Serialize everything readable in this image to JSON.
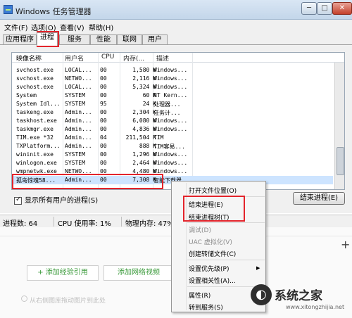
{
  "window": {
    "title": "Windows 任务管理器"
  },
  "window_controls": {
    "minimize": "─",
    "maximize": "□",
    "close": "✕"
  },
  "menu": {
    "items": [
      "文件(F)",
      "选项(O)",
      "查看(V)",
      "帮助(H)"
    ]
  },
  "tabs": [
    "应用程序",
    "进程",
    "服务",
    "性能",
    "联网",
    "用户"
  ],
  "active_tab": "进程",
  "table": {
    "headers": [
      "映像名称",
      "用户名",
      "CPU",
      "内存(...",
      "描述"
    ],
    "rows": [
      [
        "svchost.exe",
        "LOCAL...",
        "00",
        "1,580 K",
        "Windows..."
      ],
      [
        "svchost.exe",
        "NETWO...",
        "00",
        "2,116 K",
        "Windows..."
      ],
      [
        "svchost.exe",
        "LOCAL...",
        "00",
        "5,324 K",
        "Windows..."
      ],
      [
        "System",
        "SYSTEM",
        "00",
        "60 K",
        "NT Kern..."
      ],
      [
        "System Idl...",
        "SYSTEM",
        "95",
        "24 K",
        "处理器..."
      ],
      [
        "taskeng.exe",
        "Admin...",
        "00",
        "2,304 K",
        "任务计..."
      ],
      [
        "taskhost.exe",
        "Admin...",
        "00",
        "6,080 K",
        "Windows..."
      ],
      [
        "taskmgr.exe",
        "Admin...",
        "00",
        "4,836 K",
        "Windows..."
      ],
      [
        "TIM.exe *32",
        "Admin...",
        "04",
        "211,504 K",
        "TIM"
      ],
      [
        "TXPlatform...",
        "Admin...",
        "00",
        "888 K",
        "TIM客易..."
      ],
      [
        "wininit.exe",
        "SYSTEM",
        "00",
        "1,296 K",
        "Windows..."
      ],
      [
        "winlogon.exe",
        "SYSTEM",
        "00",
        "2,464 K",
        "Windows..."
      ],
      [
        "wmpnetwk.exe",
        "NETWO...",
        "00",
        "4,480 K",
        "Windows..."
      ],
      [
        "孤岛惊魂58...",
        "Admin...",
        "00",
        "7,308 K",
        "智能下载器"
      ]
    ],
    "selected_index": 13
  },
  "show_all_users": {
    "label": "显示所有用户的进程(S)",
    "checked": true
  },
  "end_process_button": "结束进程(E)",
  "status": {
    "processes": "进程数: 64",
    "cpu": "CPU 使用率: 1%",
    "memory": "物理内存: 47%"
  },
  "context_menu": {
    "items": [
      {
        "label": "打开文件位置(O)",
        "disabled": false
      },
      {
        "label": "结束进程(E)",
        "disabled": false
      },
      {
        "label": "结束进程树(T)",
        "disabled": false
      },
      {
        "label": "调试(D)",
        "disabled": true
      },
      {
        "label": "UAC 虚拟化(V)",
        "disabled": true
      },
      {
        "label": "创建转储文件(C)",
        "disabled": false
      },
      {
        "label": "设置优先级(P)",
        "disabled": false,
        "submenu": true
      },
      {
        "label": "设置相关性(A)...",
        "disabled": false
      },
      {
        "label": "属性(R)",
        "disabled": false
      },
      {
        "label": "转到服务(S)",
        "disabled": false
      }
    ]
  },
  "background_page": {
    "buttons": [
      "+ 添加经验引用",
      "添加网络视频"
    ],
    "hint": "从右侧图库拖动图片到此处",
    "plus": "+"
  },
  "watermark": {
    "name": "系统之家",
    "url": "www.xitongzhijia.net"
  },
  "colors": {
    "annotation": "#e3242b",
    "selected_row": "#cde4ff",
    "green_text": "#3a9a3a"
  }
}
